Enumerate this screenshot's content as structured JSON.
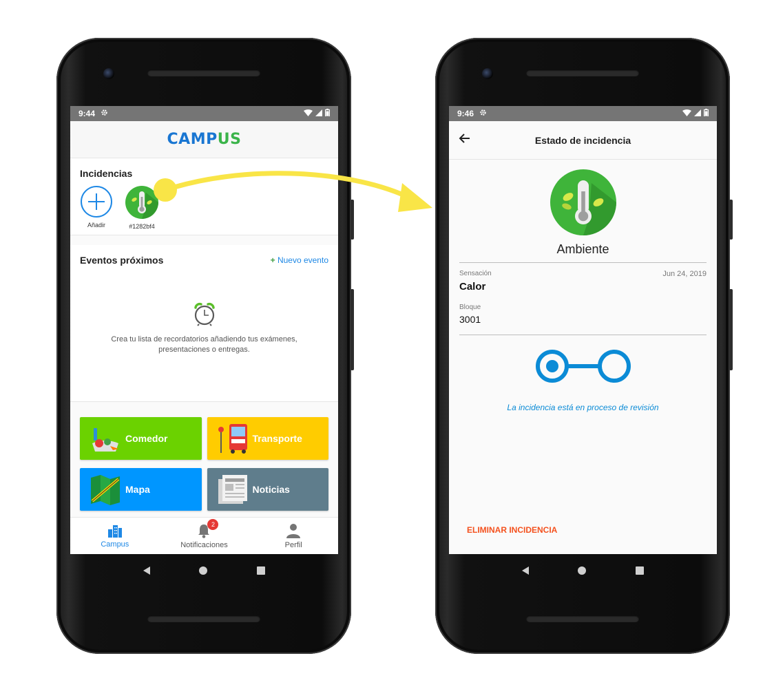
{
  "left": {
    "status": {
      "time": "9:44"
    },
    "app_title": {
      "part1": "CAMP",
      "part2": "US"
    },
    "incidencias": {
      "title": "Incidencias",
      "add_label": "Añadir",
      "items": [
        {
          "id": "#1282bf4",
          "icon": "thermometer-leaf-icon"
        }
      ]
    },
    "eventos": {
      "title": "Eventos próximos",
      "new_event_plus": "+",
      "new_event_label": "Nuevo evento",
      "empty_icon": "alarm-clock-icon",
      "empty_text": "Crea tu lista de recordatorios añadiendo tus exámenes, presentaciones o entregas."
    },
    "tiles": [
      {
        "label": "Comedor",
        "icon": "food-icon",
        "color": "#6bd200"
      },
      {
        "label": "Transporte",
        "icon": "bus-stop-icon",
        "color": "#ffcc00"
      },
      {
        "label": "Mapa",
        "icon": "map-icon",
        "color": "#0096ff"
      },
      {
        "label": "Noticias",
        "icon": "newspaper-icon",
        "color": "#5f7d8c"
      }
    ],
    "bottom_nav": [
      {
        "label": "Campus",
        "icon": "campus-building-icon",
        "active": true
      },
      {
        "label": "Notificaciones",
        "icon": "bell-icon",
        "badge": "2"
      },
      {
        "label": "Perfil",
        "icon": "person-icon"
      }
    ]
  },
  "right": {
    "status": {
      "time": "9:46"
    },
    "header_title": "Estado de incidencia",
    "category": "Ambiente",
    "sensacion_label": "Sensación",
    "date": "Jun 24, 2019",
    "sensacion_value": "Calor",
    "bloque_label": "Bloque",
    "bloque_value": "3001",
    "status_text": "La incidencia está en proceso de revisión",
    "delete_label": "ELIMINAR INCIDENCIA"
  },
  "colors": {
    "accent": "#1e88e5",
    "progress": "#0b8bd6",
    "danger": "#f4511e",
    "arrow": "#f9e547"
  }
}
